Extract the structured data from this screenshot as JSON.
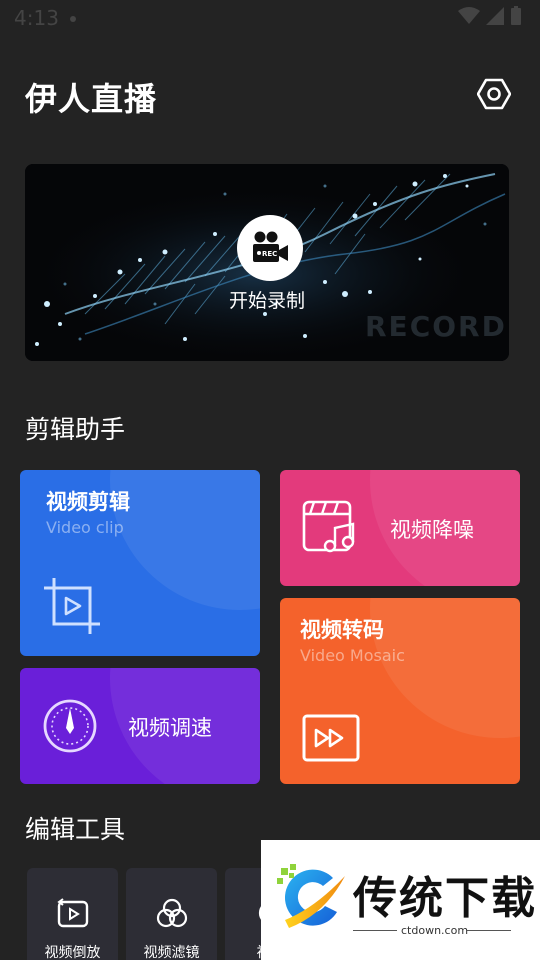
{
  "status_bar": {
    "time": "4:13"
  },
  "header": {
    "title": "伊人直播",
    "settings_icon": "settings-hexagon-icon"
  },
  "record": {
    "label": "开始录制",
    "watermark": "RECORD",
    "icon": "video-camera-rec-icon"
  },
  "sections": {
    "editing_assistant": "剪辑助手",
    "editing_tools": "编辑工具"
  },
  "cards": {
    "video_clip": {
      "title": "视频剪辑",
      "subtitle": "Video clip",
      "icon": "crop-play-icon",
      "color": "#2a6ee6"
    },
    "video_denoise": {
      "title": "视频降噪",
      "icon": "clapperboard-music-icon",
      "color": "#e33a7c"
    },
    "video_transcode": {
      "title": "视频转码",
      "subtitle": "Video Mosaic",
      "icon": "fast-forward-box-icon",
      "color": "#f4622c"
    },
    "video_speed": {
      "title": "视频调速",
      "icon": "speedometer-icon",
      "color": "#6a1fd9"
    }
  },
  "tools": [
    {
      "label": "视频倒放",
      "icon": "reverse-play-icon"
    },
    {
      "label": "视频滤镜",
      "icon": "filter-circles-icon"
    },
    {
      "label": "视频",
      "icon": "tool-icon"
    }
  ],
  "overlay_watermark": {
    "brand": "传统下载",
    "url": "ctdown.com"
  }
}
